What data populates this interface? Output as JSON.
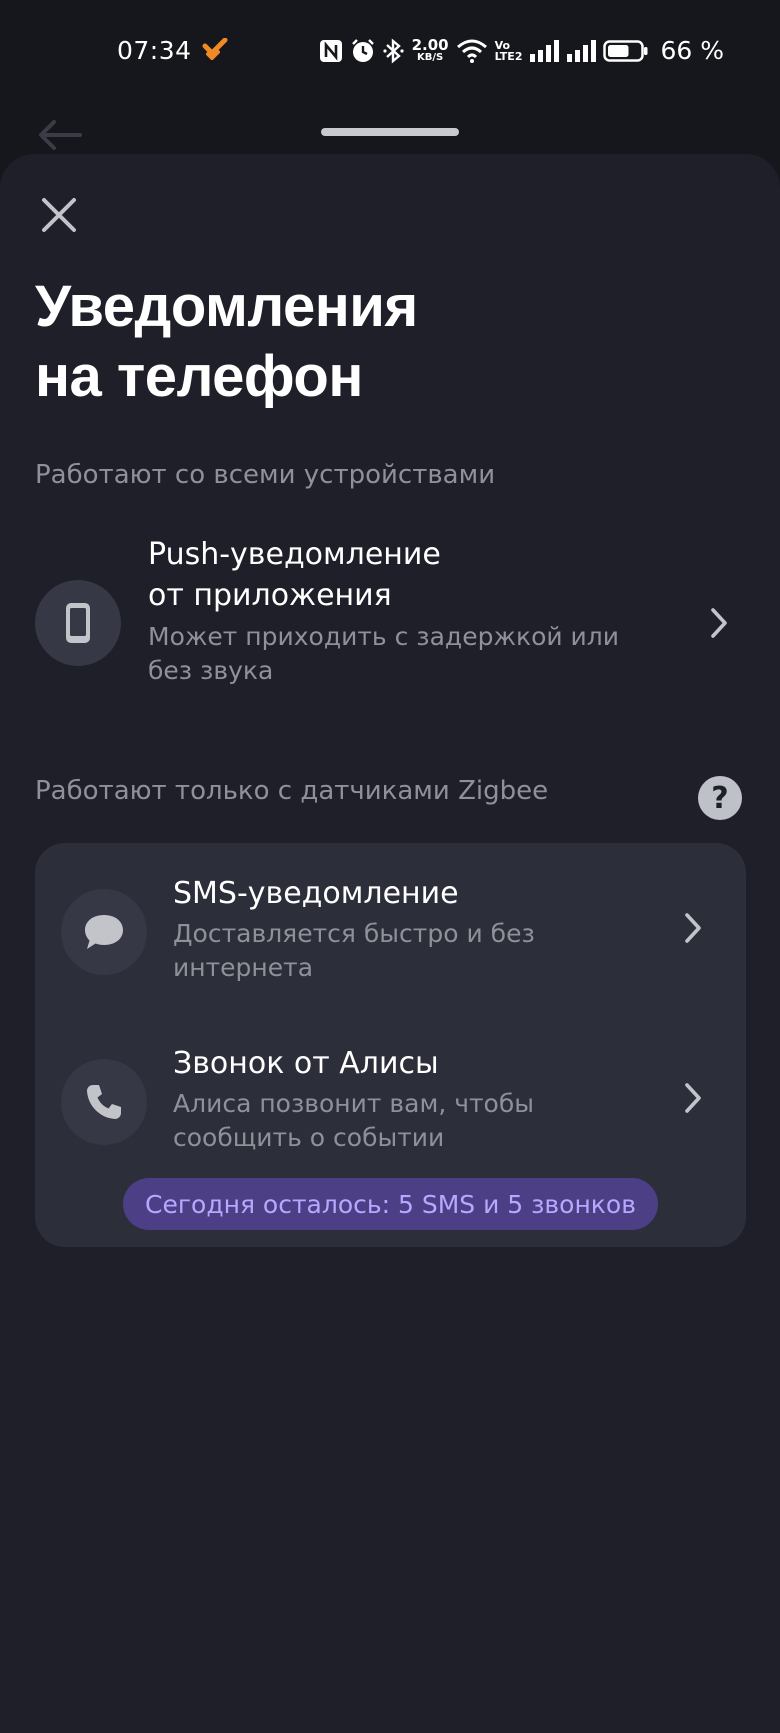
{
  "status_bar": {
    "time": "07:34",
    "net_speed_value": "2.00",
    "net_speed_unit": "KB/S",
    "volte_top": "Vo",
    "volte_bottom": "LTE2",
    "battery_percent": "66 %",
    "battery_level": 0.66
  },
  "sheet": {
    "title_line1": "Уведомления",
    "title_line2": "на телефон"
  },
  "section_all": {
    "label": "Работают со всеми устройствами"
  },
  "push_option": {
    "title_line1": "Push-уведомление",
    "title_line2": "от приложения",
    "desc_line1": "Может приходить с задержкой или",
    "desc_line2": "без звука",
    "icon": "phone-icon"
  },
  "section_zigbee": {
    "label": "Работают только с датчиками Zigbee",
    "help_glyph": "?"
  },
  "sms_option": {
    "title": "SMS-уведомление",
    "desc_line1": "Доставляется быстро и без",
    "desc_line2": "интернета",
    "icon": "chat-bubble-icon"
  },
  "call_option": {
    "title": "Звонок от Алисы",
    "desc_line1": "Алиса позвонит вам, чтобы",
    "desc_line2": "сообщить о событии",
    "icon": "phone-handset-icon"
  },
  "quota": {
    "text": "Сегодня осталось: 5 SMS и 5 звонков"
  },
  "colors": {
    "background": "#16171c",
    "sheet": "#1e1f28",
    "card": "#2c2e3a",
    "icon_circle": "#363845",
    "muted_text": "#8f9098",
    "pill_bg": "#4c3f86",
    "pill_text": "#b7a8ff"
  }
}
